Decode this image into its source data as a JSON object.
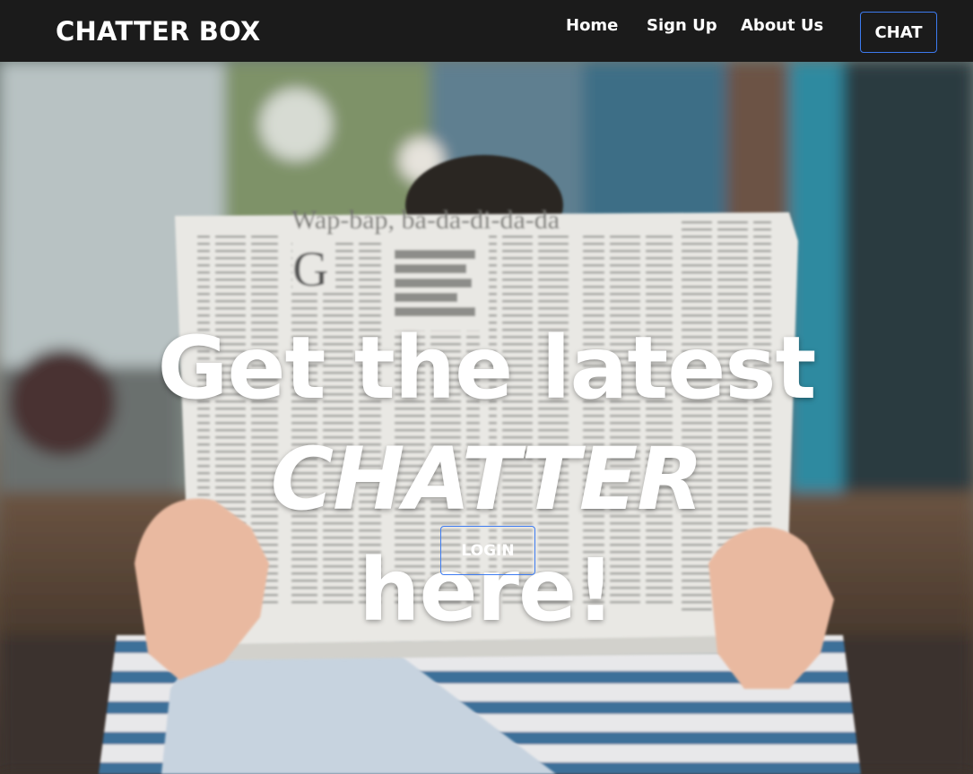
{
  "navbar": {
    "brand": "CHATTER BOX",
    "links": [
      "Home",
      "Sign Up",
      "About Us"
    ],
    "chat_label": "CHAT"
  },
  "hero": {
    "title_plain": "Get the latest",
    "title_emphasis": "CHATTER",
    "title_end": "here!",
    "login_label": "LOGIN",
    "image": "blurred photo of a person reading a newspaper",
    "newspaper_headline": "Wap-bap, ba-da-di-da-da"
  },
  "colors": {
    "navbar_bg": "#1b1b1b",
    "button_border": "#3d7bf0",
    "text": "#ffffff"
  }
}
